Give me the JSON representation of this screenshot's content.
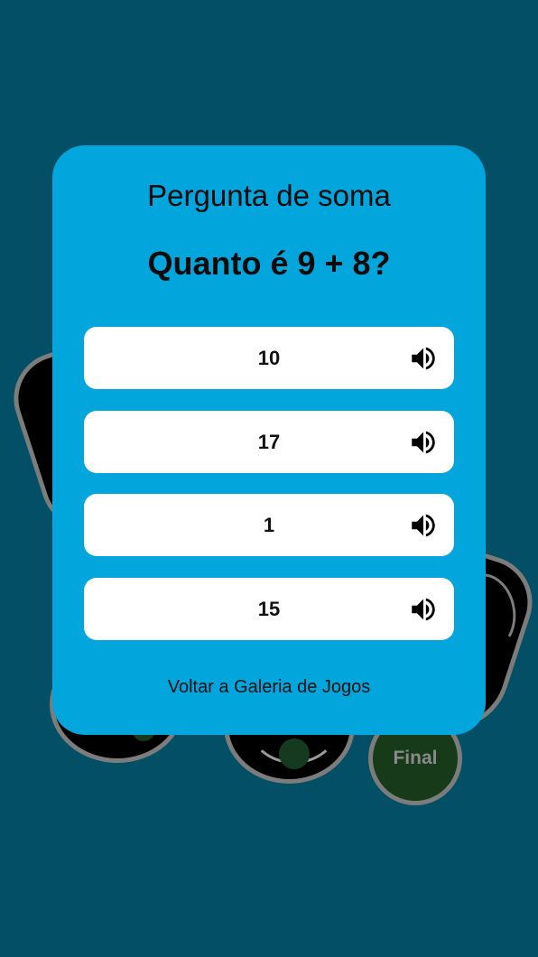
{
  "background": {
    "final_node_label": "Final"
  },
  "modal": {
    "heading": "Pergunta de soma",
    "question": "Quanto é 9 + 8?",
    "answers": [
      {
        "label": "10"
      },
      {
        "label": "17"
      },
      {
        "label": "1"
      },
      {
        "label": "15"
      }
    ],
    "back_link": "Voltar a Galeria de Jogos"
  },
  "colors": {
    "background": "#034f66",
    "modal": "#03a6dc",
    "answer_button": "#ffffff",
    "node_border": "#7c7c7c",
    "final_node_fill": "#173a18"
  },
  "icons": {
    "answer_audio": "speaker-icon"
  }
}
